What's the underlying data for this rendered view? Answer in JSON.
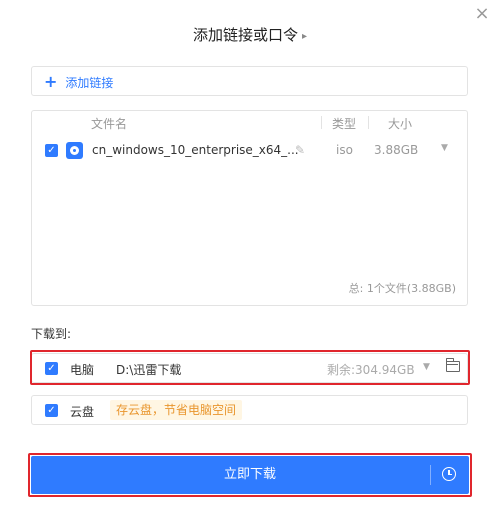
{
  "dialog": {
    "title": "添加链接或口令",
    "title_arrow": "▸",
    "close": "×"
  },
  "add_link": {
    "label": "添加链接",
    "icon": "+"
  },
  "file_table": {
    "columns": {
      "name": "文件名",
      "type": "类型",
      "size": "大小"
    },
    "rows": [
      {
        "checked": true,
        "name": "cn_windows_10_enterprise_x64_...",
        "type": "iso",
        "size": "3.88GB"
      }
    ],
    "summary": "总:  1个文件(3.88GB)"
  },
  "download_to": {
    "label": "下载到:",
    "computer": {
      "checked": true,
      "label": "电脑",
      "path": "D:\\迅雷下载",
      "free_space": "剩余:304.94GB"
    },
    "cloud": {
      "checked": true,
      "label": "云盘",
      "tip": "存云盘，节省电脑空间"
    }
  },
  "primary_button": {
    "label": "立即下载"
  },
  "colors": {
    "accent": "#2f7bff",
    "highlight": "#e0262d",
    "tip_bg": "#fff6e3",
    "tip_fg": "#e9962e"
  }
}
